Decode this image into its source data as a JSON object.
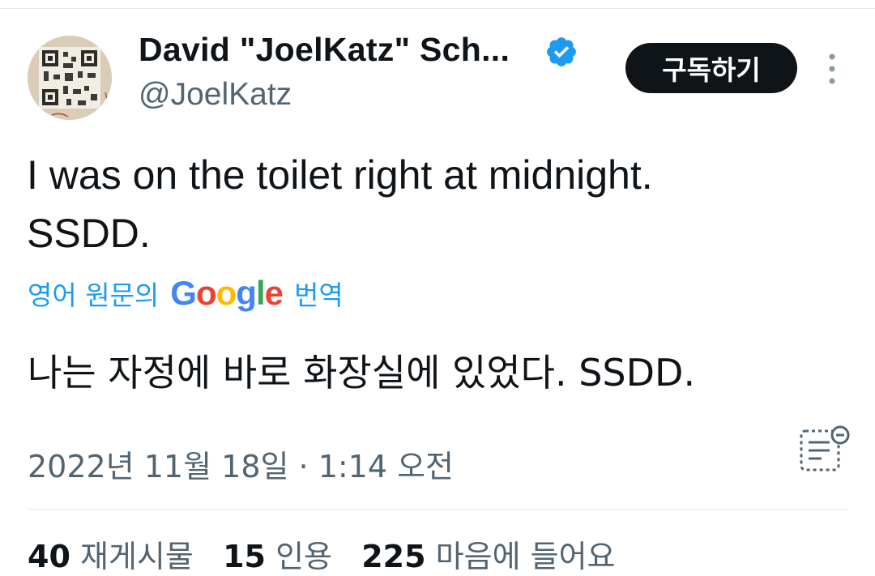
{
  "author": {
    "name": "David \"JoelKatz\" Sch...",
    "handle": "@JoelKatz",
    "verified": true
  },
  "actions": {
    "subscribe_label": "구독하기"
  },
  "tweet": {
    "text_line1": "I was on the toilet right at midnight.",
    "text_line2": "SSDD."
  },
  "translation": {
    "prefix": "영어 원문의",
    "engine": "Google",
    "suffix": "번역",
    "text": "나는 자정에 바로 화장실에 있었다. SSDD."
  },
  "meta": {
    "timestamp": "2022년 11월 18일 · 1:14 오전"
  },
  "stats": {
    "retweets_count": "40",
    "retweets_label": "재게시물",
    "quotes_count": "15",
    "quotes_label": "인용",
    "likes_count": "225",
    "likes_label": "마음에 들어요"
  },
  "colors": {
    "text": "#0f1419",
    "secondary": "#536471",
    "link": "#1d9bf0",
    "verified": "#1d9bf0",
    "button_bg": "#0f1419"
  },
  "icons": {
    "verified": "verified-badge-icon",
    "more": "more-vertical-icon",
    "notes": "community-notes-icon"
  }
}
